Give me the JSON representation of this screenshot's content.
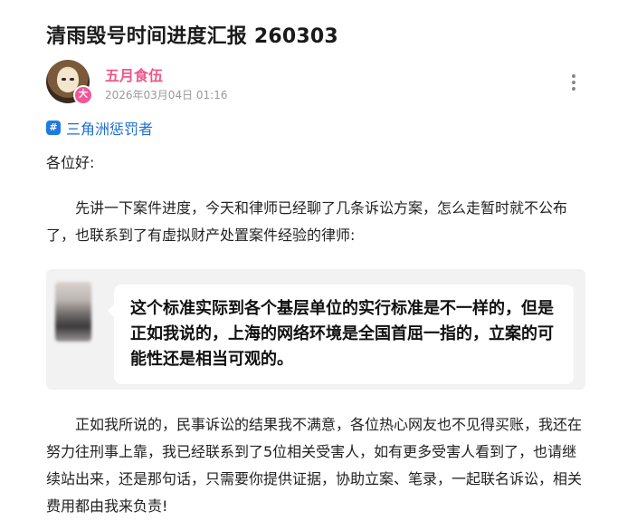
{
  "post": {
    "title": "清雨毁号时间进度汇报 260303",
    "author": {
      "name": "五月食伍",
      "badge": "大"
    },
    "timestamp": "2026年03月04日 01:16",
    "topic": {
      "icon": "#",
      "label": "三角洲惩罚者"
    },
    "greeting": "各位好:",
    "paragraph1": "先讲一下案件进度，今天和律师已经聊了几条诉讼方案，怎么走暂时就不公布了，也联系到了有虚拟财产处置案件经验的律师:",
    "quote_text": "这个标准实际到各个基层单位的实行标准是不一样的，但是正如我说的，上海的网络环境是全国首屈一指的，立案的可能性还是相当可观的。",
    "paragraph2": "正如我所说的，民事诉讼的结果我不满意，各位热心网友也不见得买账，我还在努力往刑事上靠，我已经联系到了5位相关受害人，如有更多受害人看到了，也请继续站出来，还是那句话，只需要你提供证据，协助立案、笔录，一起联名诉讼，相关费用都由我来负责!"
  },
  "colors": {
    "author_name": "#f0578c",
    "topic_link": "#1f6fd1",
    "quote_background": "#f2f2f2"
  },
  "icons": {
    "more": "more-vertical-icon",
    "topic": "hashtag-icon"
  }
}
